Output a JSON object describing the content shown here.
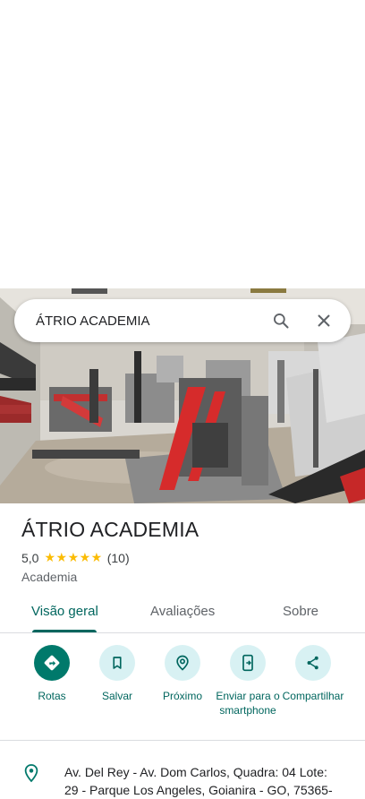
{
  "search": {
    "query": "ÁTRIO ACADEMIA"
  },
  "place": {
    "name": "ÁTRIO ACADEMIA",
    "rating": "5,0",
    "stars": "★★★★★",
    "review_count": "(10)",
    "category": "Academia"
  },
  "tabs": [
    {
      "label": "Visão geral",
      "active": true
    },
    {
      "label": "Avaliações",
      "active": false
    },
    {
      "label": "Sobre",
      "active": false
    }
  ],
  "actions": [
    {
      "label": "Rotas",
      "icon": "directions-icon"
    },
    {
      "label": "Salvar",
      "icon": "bookmark-icon"
    },
    {
      "label": "Próximo",
      "icon": "nearby-icon"
    },
    {
      "label": "Enviar para o smartphone",
      "icon": "send-to-phone-icon"
    },
    {
      "label": "Compartilhar",
      "icon": "share-icon"
    }
  ],
  "address": "Av. Del Rey - Av. Dom Carlos, Quadra: 04 Lote: 29 - Parque Los Angeles, Goianira - GO, 75365-",
  "colors": {
    "accent": "#00665e",
    "primary_button": "#00796b",
    "chip_bg": "#d8f1f3",
    "star": "#fbbc04"
  }
}
